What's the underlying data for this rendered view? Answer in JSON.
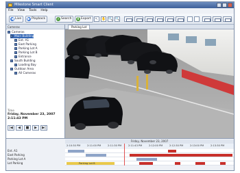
{
  "window": {
    "title": "Milestone Smart Client",
    "close_symbol": "×"
  },
  "menu": [
    "File",
    "View",
    "Tools",
    "Help"
  ],
  "toolbar": {
    "live_label": "Live",
    "browse_label": "Playback",
    "search_label": "Search",
    "export_label": "Export",
    "live_icon": "◀",
    "browse_icon": "▶",
    "search_icon": "⌕",
    "export_icon": "⬇",
    "tool_icons": [
      "↖",
      "✋",
      "🔍",
      "🔍"
    ]
  },
  "tabs": {
    "active": "Parking Lot"
  },
  "left_panel": {
    "title": "Cameras",
    "tree": [
      {
        "label": "Cameras",
        "level": 0
      },
      {
        "label": "Main Building",
        "level": 1,
        "selected": true
      },
      {
        "label": "Ent. A1",
        "level": 2
      },
      {
        "label": "East Parking",
        "level": 2
      },
      {
        "label": "Parking Lot A",
        "level": 2
      },
      {
        "label": "Parking Lot B",
        "level": 2
      },
      {
        "label": "Entrance",
        "level": 2
      },
      {
        "label": "South Building",
        "level": 1
      },
      {
        "label": "Loading Bay",
        "level": 2
      },
      {
        "label": "Outdoor Area",
        "level": 1
      },
      {
        "label": "All Cameras",
        "level": 2
      }
    ],
    "date_label": "Time",
    "date_line1": "Friday, November 23, 2007",
    "date_line2": "2:11:43 PM",
    "controls": [
      "|◀",
      "◀",
      "■",
      "▶",
      "▶|"
    ]
  },
  "timeline": {
    "header": "Friday, November 23, 2007",
    "ticks": [
      "2:10:30 PM",
      "2:11:00 PM",
      "2:11:30 PM",
      "2:11:43 PM",
      "2:12:00 PM",
      "2:12:30 PM",
      "2:13:00 PM",
      "2:13:30 PM"
    ],
    "rows": [
      {
        "label": "Ent. A1"
      },
      {
        "label": "East Parking"
      },
      {
        "label": "Parking Lot A"
      },
      {
        "label": "Lot Parking"
      }
    ],
    "playhead_label": "Lot Parking",
    "highlight_label": "Parking Lot B",
    "colors": {
      "motion": "#c8302a",
      "recorded": "#8ea4c8",
      "selection": "#e9c84a"
    }
  }
}
